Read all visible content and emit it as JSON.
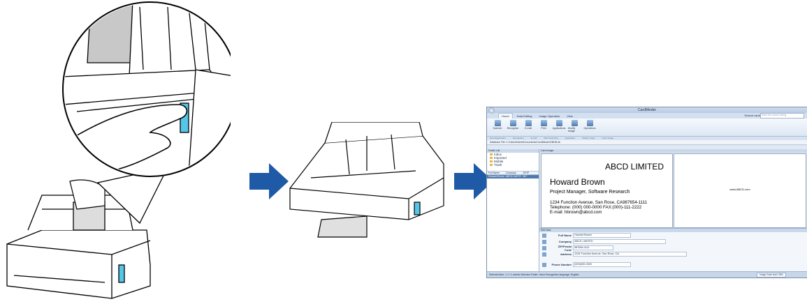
{
  "app": {
    "window_title": "CardMinder",
    "tabs": [
      "Home",
      "Data Editing",
      "Image Operation",
      "View"
    ],
    "search_label": "Search cards",
    "search_placeholder": "Enter the search string",
    "ribbon_buttons": [
      "Scanner",
      "Recognize",
      "E-mail",
      "Print",
      "Applications",
      "Modify Image",
      "Operations"
    ],
    "ribbon_groups": [
      "New Registration",
      "Recognition",
      "E-mail",
      "Web Searching",
      "Application",
      "Modify Image",
      "Insert Image"
    ],
    "path": "Database File: C:\\Users\\Name\\Documents\\CardMinder\\DBDB.db",
    "folder_list_label": "Folder List",
    "folders": [
      "Inbox",
      "Imported",
      "Mobile",
      "Trash"
    ],
    "list_columns": [
      "Full Name",
      "Company",
      "ZIP/P"
    ],
    "list_row": [
      "Howard Brown",
      "ABCD LIMITED",
      "987"
    ],
    "card_image_label": "Card Image",
    "edit_data_label": "Edit Data",
    "card_front": {
      "company": "ABCD LIMITED",
      "name": "Howard Brown",
      "title": "Project Manager, Software Research",
      "address_line": "1234 Funciton Avenue, San Rose, CA987654-1111",
      "phone_line": "Telephone: (000) 000-0000  FAX:(000)-111-2222",
      "email_line": "E-mail: hbrown@abcd.com"
    },
    "card_back": {
      "url": "www.ABCD.com"
    },
    "fields": [
      {
        "label": "Full Name",
        "value": "Howard Brown"
      },
      {
        "label": "Company",
        "value": "ABCD LIMITED"
      },
      {
        "label": "ZIP/Postal Code",
        "value": "987654-1111"
      },
      {
        "label": "Address",
        "value": "1234 Funciton Avenue, San Rose, CA"
      },
      {
        "label": "Phone Number",
        "value": "(000)000-0000"
      }
    ],
    "status": "Selected item: 1    1 / 1 sheets    Selected Folder: Inbox    Recognition language: English",
    "zoom_label": "Image Zoom level: 35%"
  },
  "colors": {
    "arrow": "#1f5aa6",
    "scanner_led": "#55c6e8",
    "ribbon_accent": "#4f79ad"
  }
}
